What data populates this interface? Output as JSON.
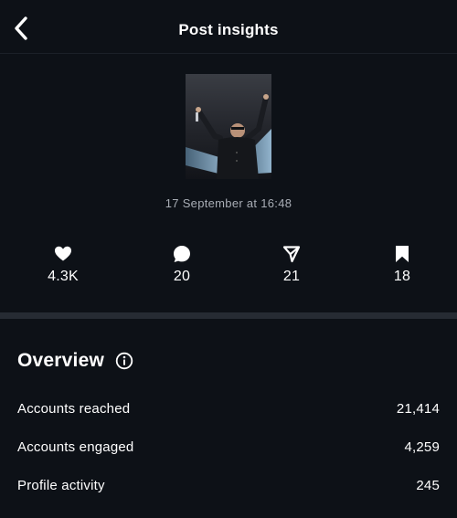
{
  "header": {
    "title": "Post insights",
    "back_icon": "chevron-left-icon"
  },
  "post": {
    "date": "17 September at 16:48",
    "thumbnail": "performer-on-stage-photo"
  },
  "stats": [
    {
      "icon": "heart-icon",
      "value": "4.3K"
    },
    {
      "icon": "comment-icon",
      "value": "20"
    },
    {
      "icon": "send-icon",
      "value": "21"
    },
    {
      "icon": "bookmark-icon",
      "value": "18"
    }
  ],
  "overview": {
    "title": "Overview",
    "info_icon": "info-icon",
    "rows": [
      {
        "label": "Accounts reached",
        "value": "21,414"
      },
      {
        "label": "Accounts engaged",
        "value": "4,259"
      },
      {
        "label": "Profile activity",
        "value": "245"
      }
    ]
  },
  "colors": {
    "background": "#0d1117",
    "text_primary": "#ffffff",
    "text_secondary": "#a8adb5",
    "divider": "#262b33"
  }
}
